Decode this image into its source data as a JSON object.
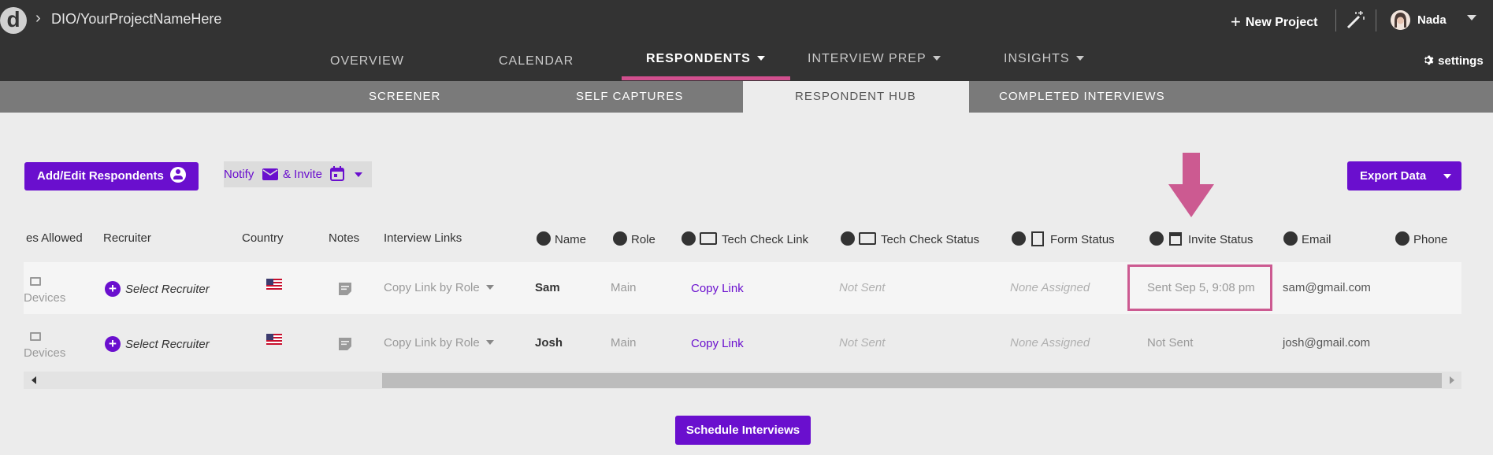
{
  "header": {
    "logo_letter": "d",
    "breadcrumb": "DIO/YourProjectNameHere",
    "new_project_label": "New Project",
    "user_name": "Nada"
  },
  "main_nav": {
    "items": [
      {
        "label": "OVERVIEW",
        "dropdown": false
      },
      {
        "label": "CALENDAR",
        "dropdown": false
      },
      {
        "label": "RESPONDENTS",
        "dropdown": true,
        "active": true
      },
      {
        "label": "INTERVIEW PREP",
        "dropdown": true
      },
      {
        "label": "INSIGHTS",
        "dropdown": true
      }
    ],
    "settings_label": "settings"
  },
  "sub_nav": {
    "items": [
      "SCREENER",
      "SELF CAPTURES",
      "RESPONDENT HUB",
      "COMPLETED INTERVIEWS"
    ],
    "active": "RESPONDENT HUB"
  },
  "toolbar": {
    "add_edit_label": "Add/Edit Respondents",
    "notify_label": "Notify",
    "invite_label": "& Invite",
    "export_label": "Export Data"
  },
  "table": {
    "headers": {
      "devices": "es Allowed",
      "recruiter": "Recruiter",
      "country": "Country",
      "notes": "Notes",
      "links": "Interview Links",
      "name": "Name",
      "role": "Role",
      "tech_link": "Tech Check Link",
      "tech_status": "Tech Check Status",
      "form_status": "Form Status",
      "invite_status": "Invite Status",
      "email": "Email",
      "phone": "Phone"
    },
    "rows": [
      {
        "devices": "Devices",
        "recruiter": "Select Recruiter",
        "links": "Copy Link by Role",
        "name": "Sam",
        "role": "Main",
        "tech_link": "Copy Link",
        "tech_status": "Not Sent",
        "form_status": "None Assigned",
        "invite_status": "Sent Sep 5, 9:08 pm",
        "email": "sam@gmail.com"
      },
      {
        "devices": "Devices",
        "recruiter": "Select Recruiter",
        "links": "Copy Link by Role",
        "name": "Josh",
        "role": "Main",
        "tech_link": "Copy Link",
        "tech_status": "Not Sent",
        "form_status": "None Assigned",
        "invite_status": "Not Sent",
        "email": "josh@gmail.com"
      }
    ]
  },
  "footer": {
    "schedule_label": "Schedule Interviews"
  },
  "colors": {
    "accent": "#6a0fce",
    "highlight": "#cc5a91",
    "topbar": "#333333"
  }
}
